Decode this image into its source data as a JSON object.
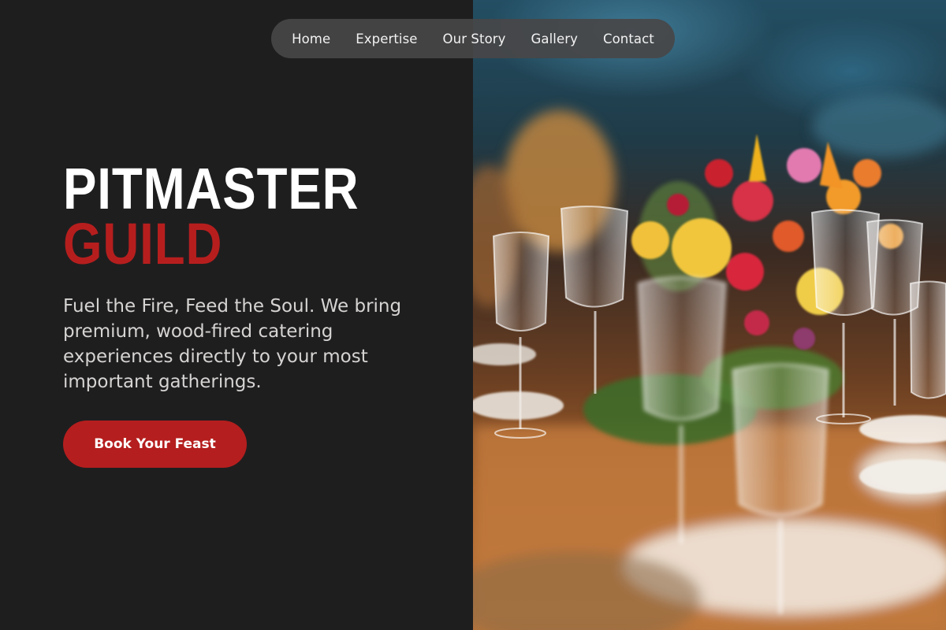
{
  "nav": {
    "items": [
      "Home",
      "Expertise",
      "Our Story",
      "Gallery",
      "Contact"
    ]
  },
  "hero": {
    "title_line1": "PITMASTER",
    "title_line2": "GUILD",
    "tagline": "Fuel the Fire, Feed the Soul. We bring premium, wood-fired catering experiences directly to your most important gatherings.",
    "cta_label": "Book Your Feast",
    "image_description": "blurred banquet table with wine glasses and colorful floral centerpiece"
  },
  "colors": {
    "background": "#1f1e1f",
    "accent": "#b51e1e",
    "nav_pill": "#484748",
    "text_light": "#ffffff",
    "text_muted": "#d6d4d2"
  }
}
